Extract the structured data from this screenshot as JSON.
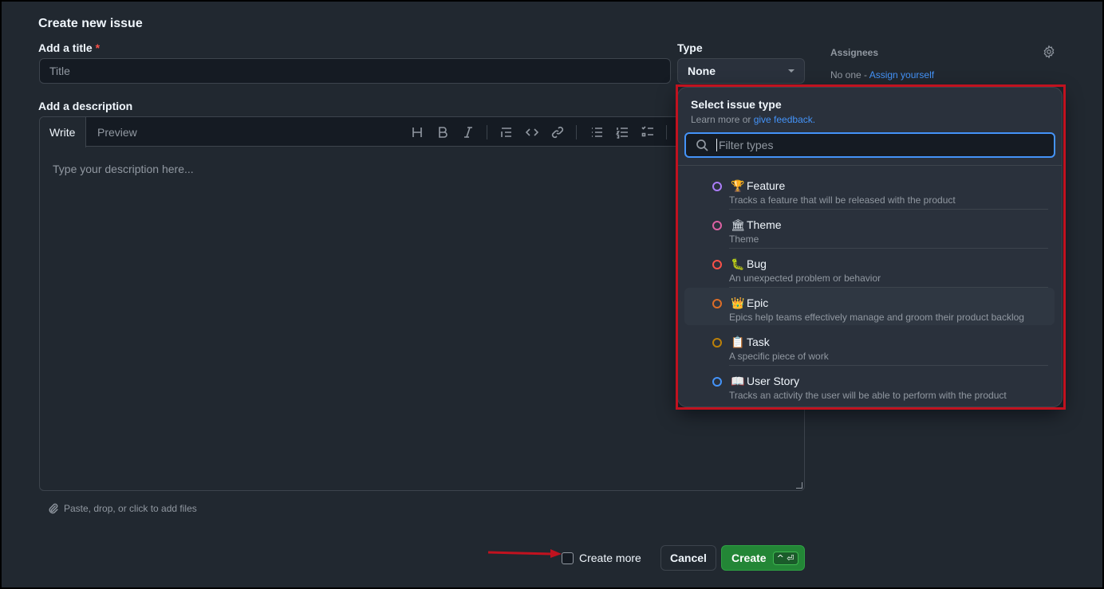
{
  "form": {
    "heading": "Create new issue",
    "title_label": "Add a title",
    "required_mark": "*",
    "title_placeholder": "Title",
    "description_label": "Add a description",
    "description_placeholder": "Type your description here...",
    "attach_hint": "Paste, drop, or click to add files"
  },
  "editor": {
    "tab_write": "Write",
    "tab_preview": "Preview",
    "tools": [
      "heading-icon",
      "bold-icon",
      "italic-icon",
      "quote-icon",
      "code-icon",
      "link-icon",
      "bullet-list-icon",
      "numbered-list-icon",
      "task-list-icon"
    ]
  },
  "type": {
    "label": "Type",
    "selected": "None"
  },
  "assignees": {
    "label": "Assignees",
    "none_text": "No one - ",
    "assign_link": "Assign yourself"
  },
  "dropdown": {
    "title": "Select issue type",
    "subtitle_prefix": "Learn more or ",
    "subtitle_link": "give feedback.",
    "filter_placeholder": "Filter types",
    "options": [
      {
        "emoji": "🏆",
        "name": "Feature",
        "desc": "Tracks a feature that will be released with the product",
        "color": "#ab7df8"
      },
      {
        "emoji": "🏛",
        "name": "Theme",
        "desc": "Theme",
        "color": "#db61a2"
      },
      {
        "emoji": "🐛",
        "name": "Bug",
        "desc": "An unexpected problem or behavior",
        "color": "#f85149"
      },
      {
        "emoji": "👑",
        "name": "Epic",
        "desc": "Epics help teams effectively manage and groom their product backlog",
        "color": "#db6d28"
      },
      {
        "emoji": "📋",
        "name": "Task",
        "desc": "A specific piece of work",
        "color": "#bb8009"
      },
      {
        "emoji": "📖",
        "name": "User Story",
        "desc": "Tracks an activity the user will be able to perform with the product",
        "color": "#4493f8"
      }
    ]
  },
  "footer": {
    "create_more": "Create more",
    "cancel": "Cancel",
    "create": "Create",
    "shortcut": "^ ⏎"
  },
  "colors": {
    "accent": "#4493f8",
    "primary_button": "#238636",
    "highlight_box": "#c1121f"
  }
}
